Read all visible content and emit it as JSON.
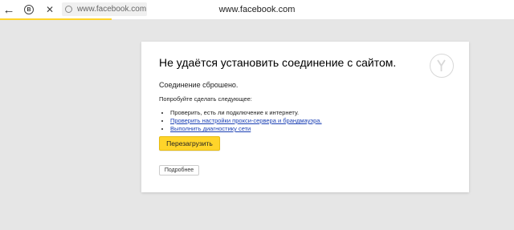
{
  "toolbar": {
    "back_icon": "arrow-left-icon",
    "protect_icon": "protect-shield-icon",
    "protect_glyph": "B",
    "close_icon": "close-icon",
    "address_value": "www.facebook.com",
    "page_title": "www.facebook.com",
    "loading_color": "#ffd42a"
  },
  "error": {
    "title": "Не удаётся установить соединение с сайтом.",
    "subtitle": "Соединение сброшено.",
    "try_label": "Попробуйте сделать следующее:",
    "suggestions": [
      {
        "text": "Проверить, есть ли подключение к интернету.",
        "link": false
      },
      {
        "text": "Проверить настройки прокси-сервера и брандмауэра.",
        "link": true
      },
      {
        "text": "Выполнить диагностику сети",
        "link": true
      }
    ],
    "reload_label": "Перезагрузить",
    "details_label": "Подробнее",
    "accent": "#ffd42a",
    "link_color": "#1a3fb4"
  }
}
